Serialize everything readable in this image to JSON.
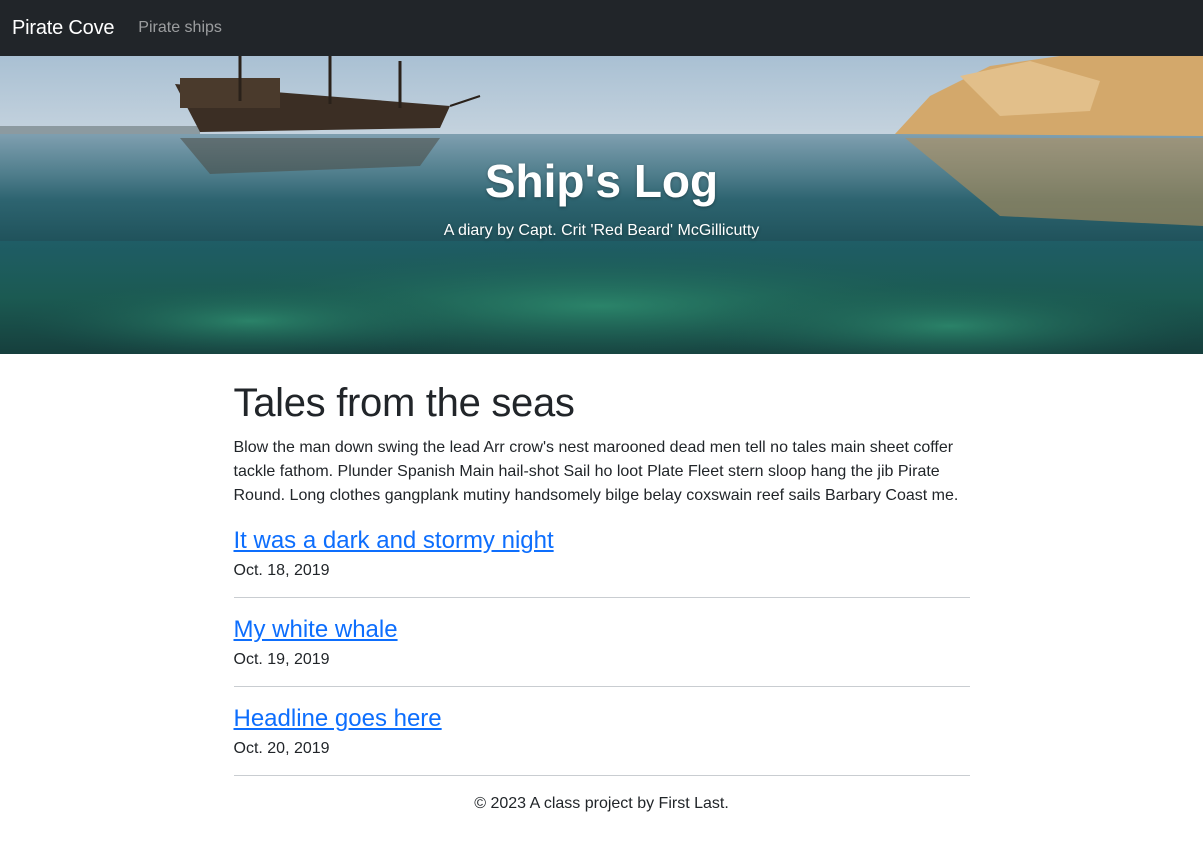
{
  "navbar": {
    "brand": "Pirate Cove",
    "links": [
      "Pirate ships"
    ]
  },
  "hero": {
    "title": "Ship's Log",
    "subtitle": "A diary by Capt. Crit 'Red Beard' McGillicutty"
  },
  "main": {
    "heading": "Tales from the seas",
    "intro": "Blow the man down swing the lead Arr crow's nest marooned dead men tell no tales main sheet coffer tackle fathom. Plunder Spanish Main hail-shot Sail ho loot Plate Fleet stern sloop hang the jib Pirate Round. Long clothes gangplank mutiny handsomely bilge belay coxswain reef sails Barbary Coast me.",
    "posts": [
      {
        "title": "It was a dark and stormy night",
        "date": "Oct. 18, 2019"
      },
      {
        "title": "My white whale",
        "date": "Oct. 19, 2019"
      },
      {
        "title": "Headline goes here",
        "date": "Oct. 20, 2019"
      }
    ]
  },
  "footer": {
    "text": "© 2023 A class project by First Last."
  },
  "colors": {
    "navbar_bg": "#212529",
    "link": "#0d6efd",
    "text": "#212529"
  }
}
